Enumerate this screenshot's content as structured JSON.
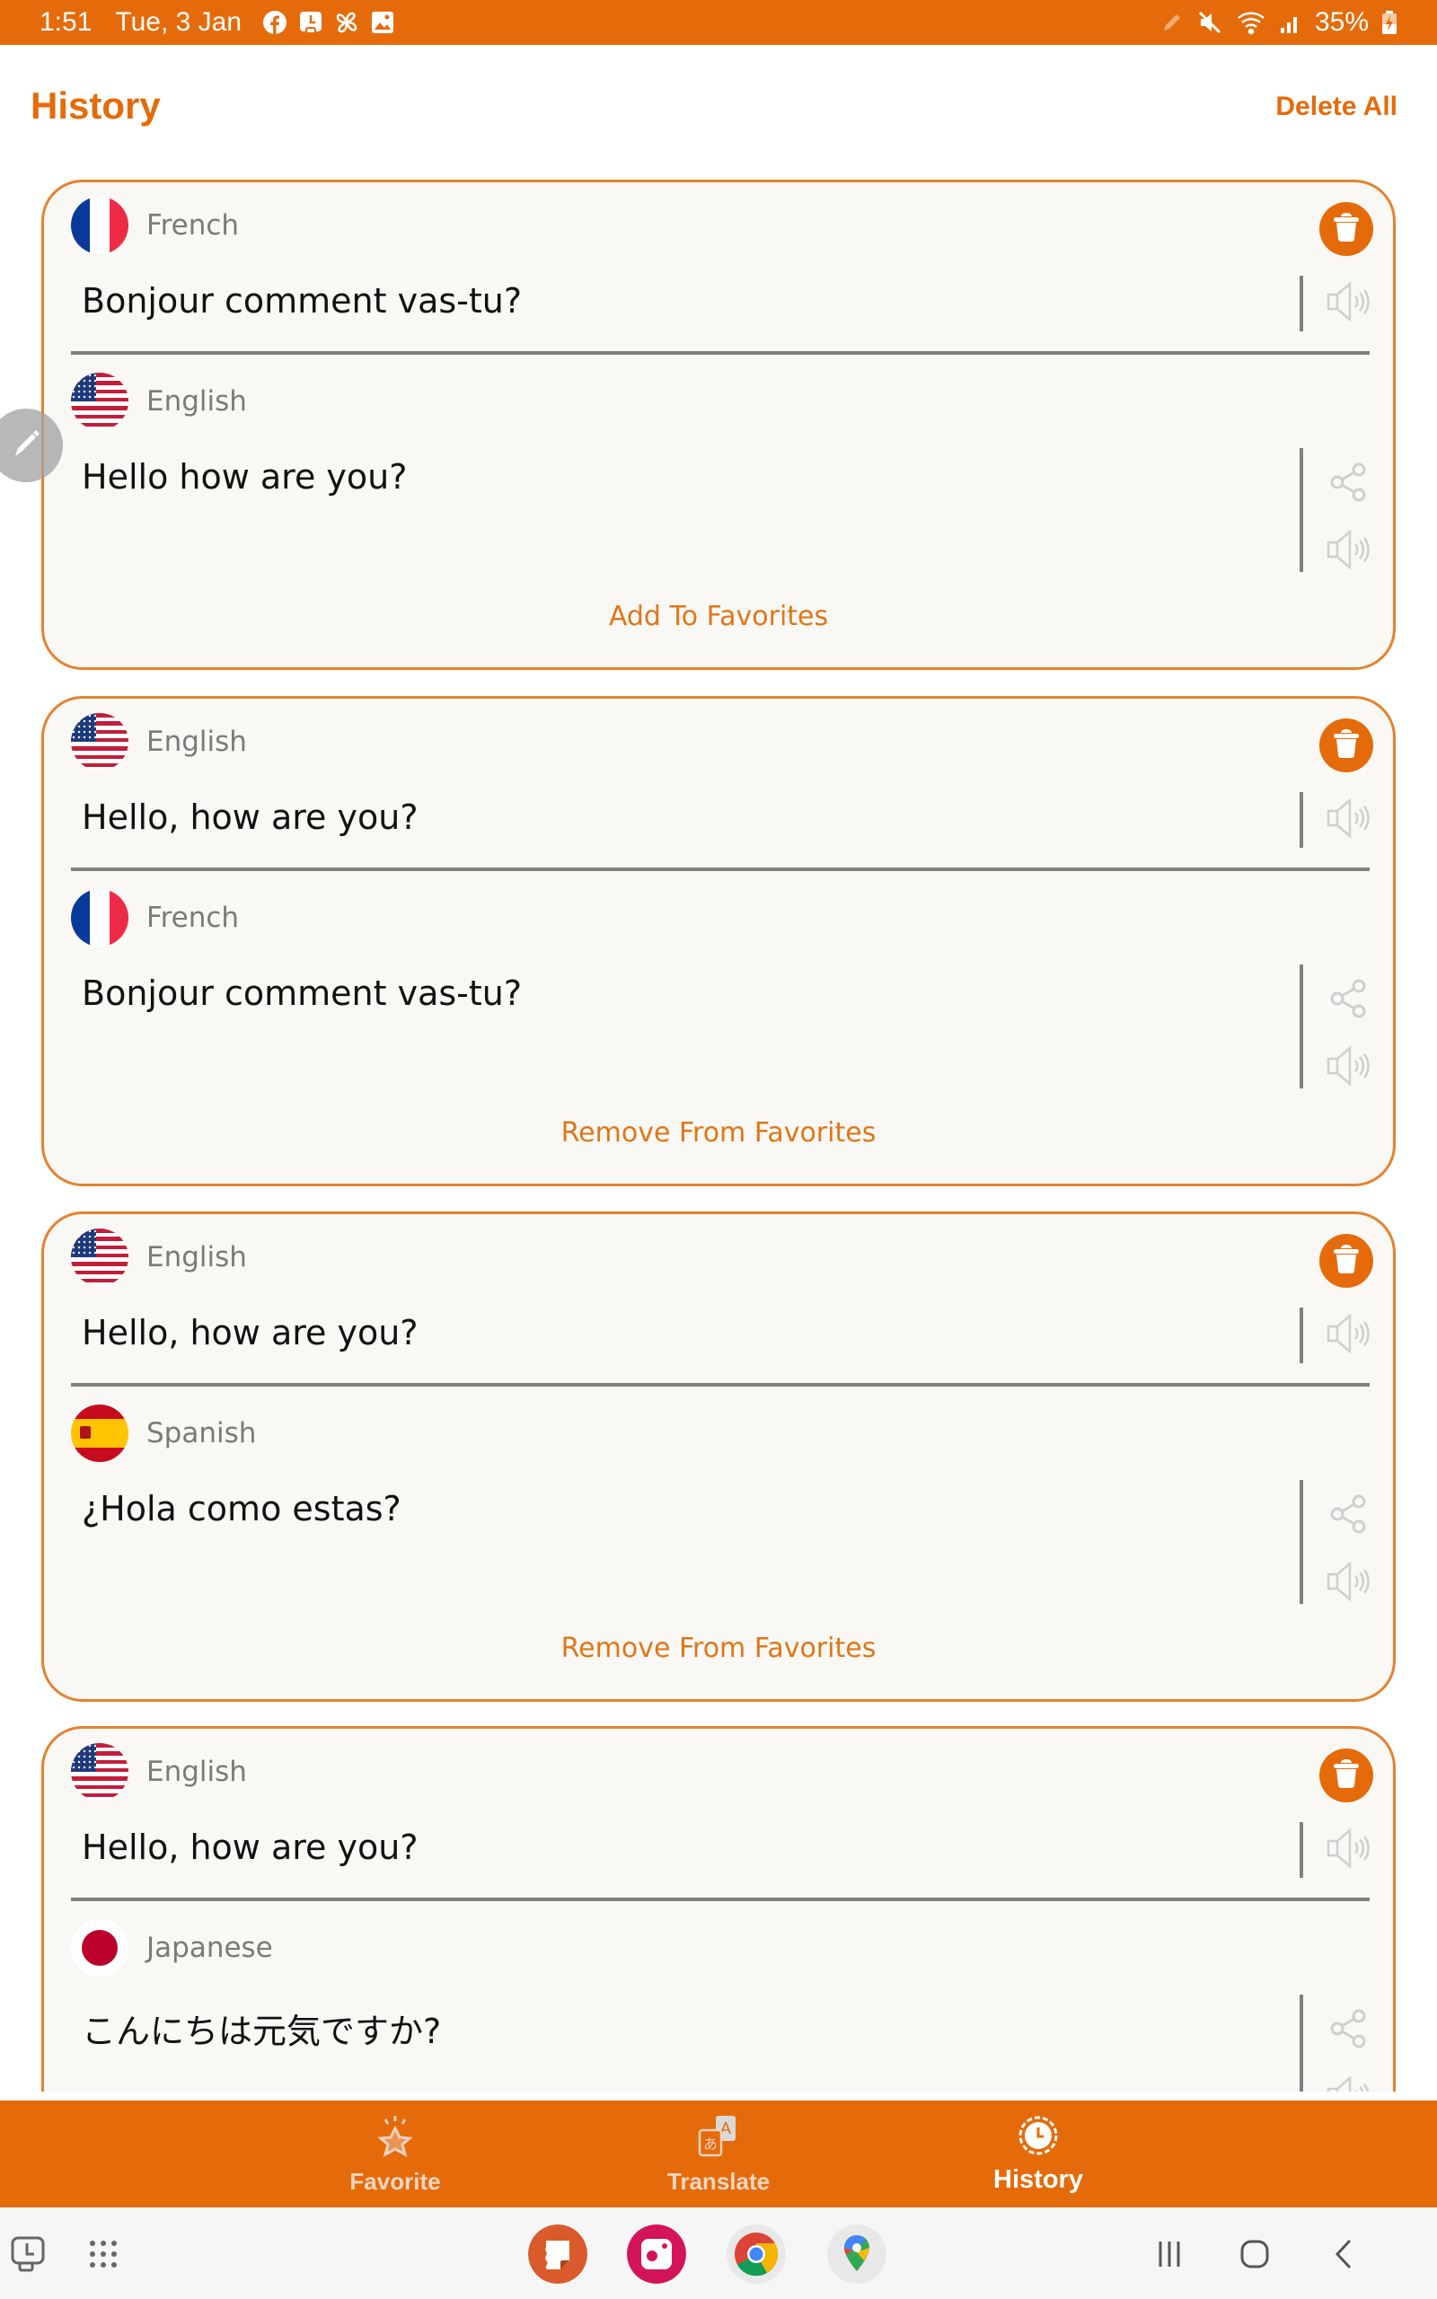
{
  "status_bar": {
    "time": "1:51",
    "date": "Tue, 3 Jan",
    "notification_icons": [
      "facebook-icon",
      "app-notification-icon",
      "pinwheel-icon",
      "gallery-icon"
    ],
    "system_icons": [
      "pen-icon",
      "mute-icon",
      "wifi-icon",
      "signal-icon"
    ],
    "battery": "35%"
  },
  "header": {
    "title": "History",
    "delete_all_label": "Delete All"
  },
  "colors": {
    "accent": "#E56B0A",
    "card_border": "#E4822F",
    "card_bg": "#FAF8F5",
    "divider": "#808080"
  },
  "history": [
    {
      "source": {
        "language": "French",
        "flag": "fr",
        "text": "Bonjour comment vas-tu?"
      },
      "target": {
        "language": "English",
        "flag": "us",
        "text": "Hello how are you?"
      },
      "favorite_action": "Add To Favorites"
    },
    {
      "source": {
        "language": "English",
        "flag": "us",
        "text": "Hello, how are you?"
      },
      "target": {
        "language": "French",
        "flag": "fr",
        "text": "Bonjour comment vas-tu?"
      },
      "favorite_action": "Remove From Favorites"
    },
    {
      "source": {
        "language": "English",
        "flag": "us",
        "text": "Hello, how are you?"
      },
      "target": {
        "language": "Spanish",
        "flag": "es",
        "text": "¿Hola como estas?"
      },
      "favorite_action": "Remove From Favorites"
    },
    {
      "source": {
        "language": "English",
        "flag": "us",
        "text": "Hello, how are you?"
      },
      "target": {
        "language": "Japanese",
        "flag": "jp",
        "text": "こんにちは元気ですか?"
      },
      "favorite_action": ""
    }
  ],
  "tabs": [
    {
      "label": "Favorite",
      "icon": "star-icon",
      "active": false
    },
    {
      "label": "Translate",
      "icon": "translate-icon",
      "active": false
    },
    {
      "label": "History",
      "icon": "history-icon",
      "active": true
    }
  ],
  "system_nav": {
    "left": [
      "screenshot-tool-icon",
      "app-drawer-icon"
    ],
    "dock_apps": [
      "notes-app-icon",
      "camera-app-icon",
      "chrome-app-icon",
      "maps-app-icon"
    ],
    "right": [
      "recents-icon",
      "home-icon",
      "back-icon"
    ]
  }
}
